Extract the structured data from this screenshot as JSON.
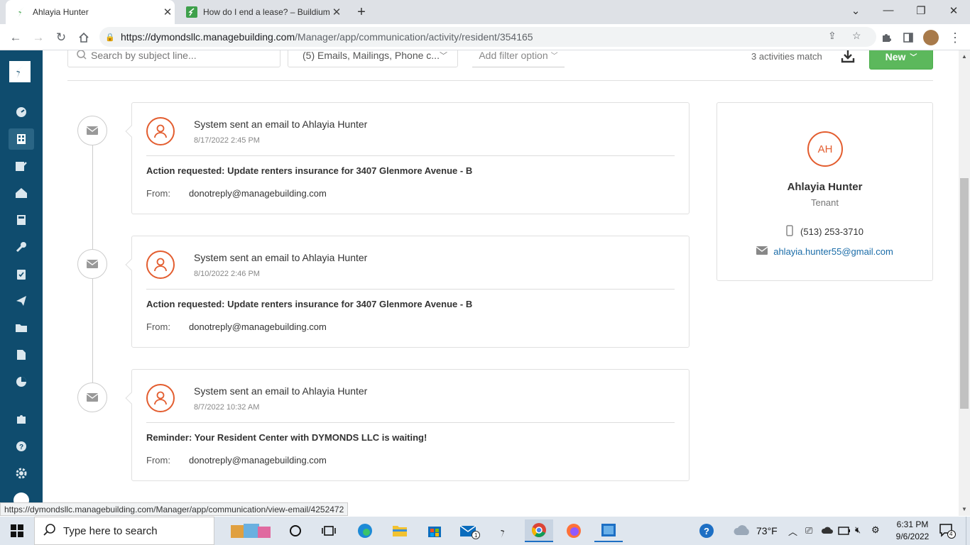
{
  "browser": {
    "tabs": [
      {
        "title": "Ahlayia Hunter",
        "active": true
      },
      {
        "title": "How do I end a lease? – Buildium",
        "active": false
      }
    ],
    "new_tab": "+",
    "url_domain": "https://dymondsllc.managebuilding.com",
    "url_path": "/Manager/app/communication/activity/resident/354165",
    "status_url": "https://dymondsllc.managebuilding.com/Manager/app/communication/view-email/4252472"
  },
  "filters": {
    "search_placeholder": "Search by subject line...",
    "type_filter": "(5) Emails, Mailings, Phone c...",
    "add_filter": "Add filter option",
    "match_count": "3 activities match",
    "new_button": "New"
  },
  "activities": [
    {
      "title": "System sent an email to Ahlayia Hunter",
      "date": "8/17/2022 2:45 PM",
      "subject": "Action requested: Update renters insurance for 3407 Glenmore Avenue - B",
      "from_label": "From:",
      "from": "donotreply@managebuilding.com"
    },
    {
      "title": "System sent an email to Ahlayia Hunter",
      "date": "8/10/2022 2:46 PM",
      "subject": "Action requested: Update renters insurance for 3407 Glenmore Avenue - B",
      "from_label": "From:",
      "from": "donotreply@managebuilding.com"
    },
    {
      "title": "System sent an email to Ahlayia Hunter",
      "date": "8/7/2022 10:32 AM",
      "subject": "Reminder: Your Resident Center with DYMONDS LLC is waiting!",
      "from_label": "From:",
      "from": "donotreply@managebuilding.com"
    }
  ],
  "contact": {
    "initials": "AH",
    "name": "Ahlayia Hunter",
    "role": "Tenant",
    "phone": "(513) 253-3710",
    "email": "ahlayia.hunter55@gmail.com"
  },
  "taskbar": {
    "search_placeholder": "Type here to search",
    "weather": "73°F",
    "time": "6:31 PM",
    "date": "9/6/2022",
    "notifications": "4"
  },
  "colors": {
    "sidebar": "#0f4c6e",
    "accent_orange": "#e35d2f",
    "new_button": "#5cb85c",
    "link": "#1a6ca8"
  }
}
